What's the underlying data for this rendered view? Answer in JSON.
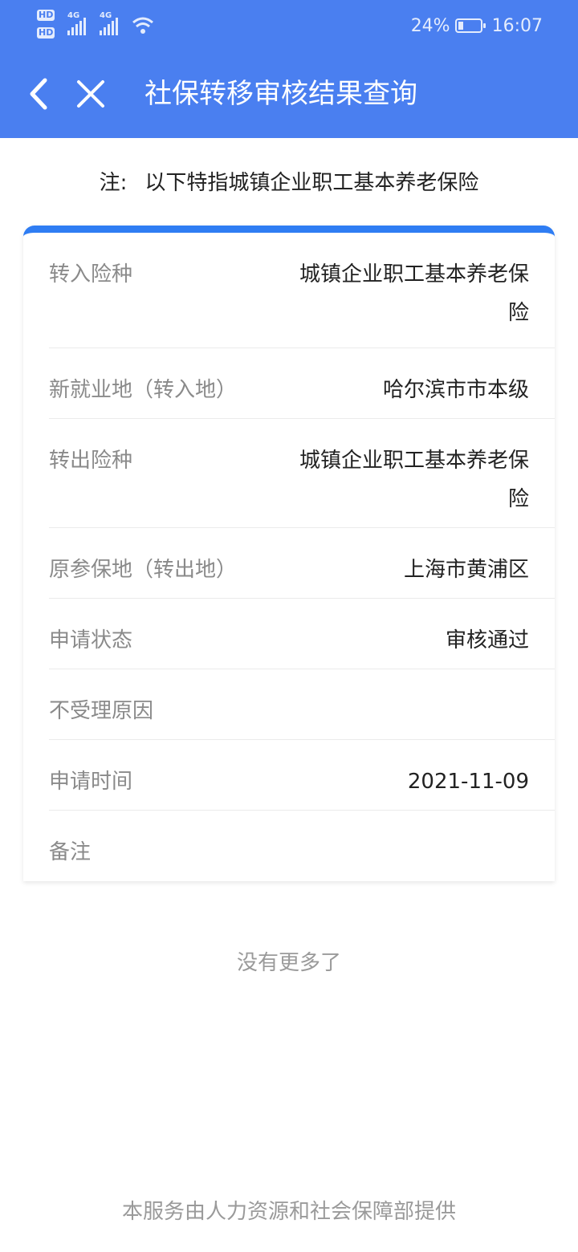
{
  "status_bar": {
    "hd1": "HD",
    "hd2": "HD",
    "network1": "4G",
    "network2": "4G",
    "battery_percent": "24%",
    "battery_level": 0.24,
    "time": "16:07"
  },
  "header": {
    "title": "社保转移审核结果查询",
    "back_icon": "chevron-left-icon",
    "close_icon": "close-icon",
    "background_color": "#4a7ff0"
  },
  "note": {
    "prefix": "注:",
    "text": "以下特指城镇企业职工基本养老保险"
  },
  "details": {
    "accent_color": "#2f7df3",
    "rows": [
      {
        "label": "转入险种",
        "value": "城镇企业职工基本养老保险"
      },
      {
        "label": "新就业地（转入地）",
        "value": "哈尔滨市市本级"
      },
      {
        "label": "转出险种",
        "value": "城镇企业职工基本养老保险"
      },
      {
        "label": "原参保地（转出地）",
        "value": "上海市黄浦区"
      },
      {
        "label": "申请状态",
        "value": "审核通过"
      },
      {
        "label": "不受理原因",
        "value": ""
      },
      {
        "label": "申请时间",
        "value": "2021-11-09"
      },
      {
        "label": "备注",
        "value": ""
      }
    ]
  },
  "no_more": "没有更多了",
  "footer": "本服务由人力资源和社会保障部提供"
}
